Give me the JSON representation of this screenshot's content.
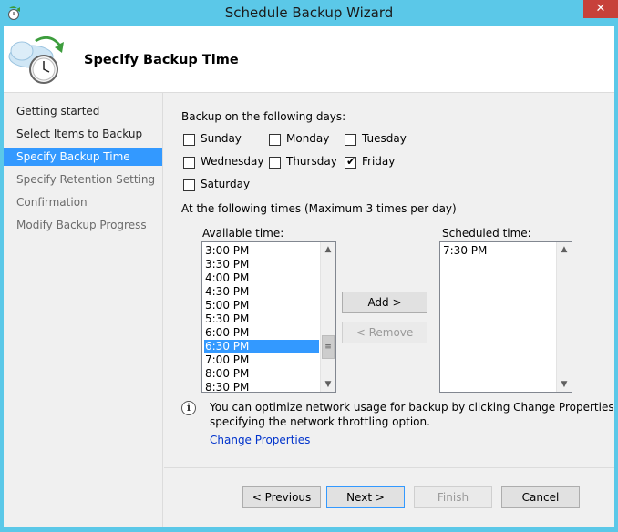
{
  "window": {
    "title": "Schedule Backup Wizard",
    "close_glyph": "✕"
  },
  "header": {
    "title": "Specify Backup Time",
    "icon": "backup-clock-icon"
  },
  "nav": {
    "items": [
      {
        "label": "Getting started"
      },
      {
        "label": "Select Items to Backup"
      },
      {
        "label": "Specify Backup Time"
      },
      {
        "label": "Specify Retention Setting"
      },
      {
        "label": "Confirmation"
      },
      {
        "label": "Modify Backup Progress"
      }
    ]
  },
  "days": {
    "heading": "Backup on the following days:",
    "sunday": {
      "label": "Sunday",
      "checked": false
    },
    "monday": {
      "label": "Monday",
      "checked": false
    },
    "tuesday": {
      "label": "Tuesday",
      "checked": false
    },
    "wednesday": {
      "label": "Wednesday",
      "checked": false
    },
    "thursday": {
      "label": "Thursday",
      "checked": false
    },
    "friday": {
      "label": "Friday",
      "checked": true
    },
    "saturday": {
      "label": "Saturday",
      "checked": false
    }
  },
  "times": {
    "heading": "At the following times (Maximum 3 times per day)",
    "available_label": "Available time:",
    "available": [
      "3:00 PM",
      "3:30 PM",
      "4:00 PM",
      "4:30 PM",
      "5:00 PM",
      "5:30 PM",
      "6:00 PM",
      "6:30 PM",
      "7:00 PM",
      "8:00 PM",
      "8:30 PM"
    ],
    "available_selected": "6:30 PM",
    "scheduled_label": "Scheduled time:",
    "scheduled": [
      "7:30 PM"
    ],
    "add_label": "Add >",
    "remove_label": "< Remove"
  },
  "info": {
    "line1": "You can optimize network usage for backup by clicking Change Properties and",
    "line2": "specifying the network throttling option.",
    "link": "Change Properties"
  },
  "footer": {
    "previous": "< Previous",
    "next": "Next >",
    "finish": "Finish",
    "cancel": "Cancel"
  }
}
